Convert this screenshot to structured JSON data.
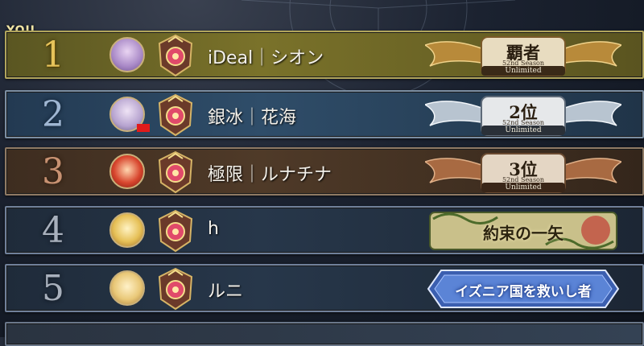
{
  "you_label": "YOU",
  "rows": [
    {
      "rank": "1",
      "name": "iDeal｜シオン",
      "badge": {
        "title": "覇者",
        "season": "52nd Season",
        "mode": "Unlimited"
      }
    },
    {
      "rank": "2",
      "name": "銀冰｜花海",
      "badge": {
        "title": "2位",
        "season": "52nd Season",
        "mode": "Unlimited"
      }
    },
    {
      "rank": "3",
      "name": "極限｜ルナチナ",
      "badge": {
        "title": "3位",
        "season": "52nd Season",
        "mode": "Unlimited"
      }
    },
    {
      "rank": "4",
      "name": "h",
      "badge": {
        "title": "約束の一矢"
      }
    },
    {
      "rank": "5",
      "name": "ルニ",
      "badge": {
        "title": "イズニア国を救いし者"
      }
    }
  ],
  "colors": {
    "gold": "#e6c35a",
    "silver": "#9fb6d2",
    "bronze": "#c89272",
    "highlight": "#b1a55c"
  }
}
